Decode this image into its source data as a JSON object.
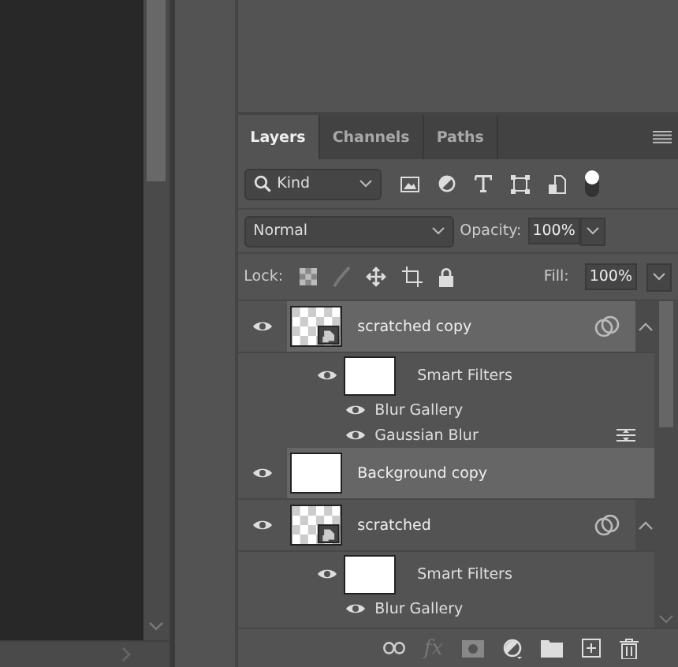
{
  "tabs": [
    {
      "label": "Layers",
      "selected": true
    },
    {
      "label": "Channels",
      "selected": false
    },
    {
      "label": "Paths",
      "selected": false
    }
  ],
  "filter": {
    "value": "Kind",
    "toggle_on": true
  },
  "blend": {
    "mode": "Normal",
    "opacity_label": "Opacity:",
    "opacity": "100%"
  },
  "lock": {
    "label": "Lock:",
    "fill_label": "Fill:",
    "fill": "100%"
  },
  "layers": [
    {
      "name": "scratched copy",
      "kind": "smart",
      "selected": true,
      "expanded": true,
      "children": [
        {
          "name": "Smart Filters",
          "children": [
            {
              "name": "Blur Gallery",
              "options": false
            },
            {
              "name": "Gaussian Blur",
              "options": true
            }
          ]
        }
      ]
    },
    {
      "name": "Background copy",
      "kind": "plain",
      "selected": true
    },
    {
      "name": "scratched",
      "kind": "smart",
      "selected": false,
      "expanded": true,
      "children": [
        {
          "name": "Smart Filters",
          "children": [
            {
              "name": "Blur Gallery",
              "options": false
            }
          ]
        }
      ]
    }
  ],
  "footer": {
    "fx": "fx"
  }
}
